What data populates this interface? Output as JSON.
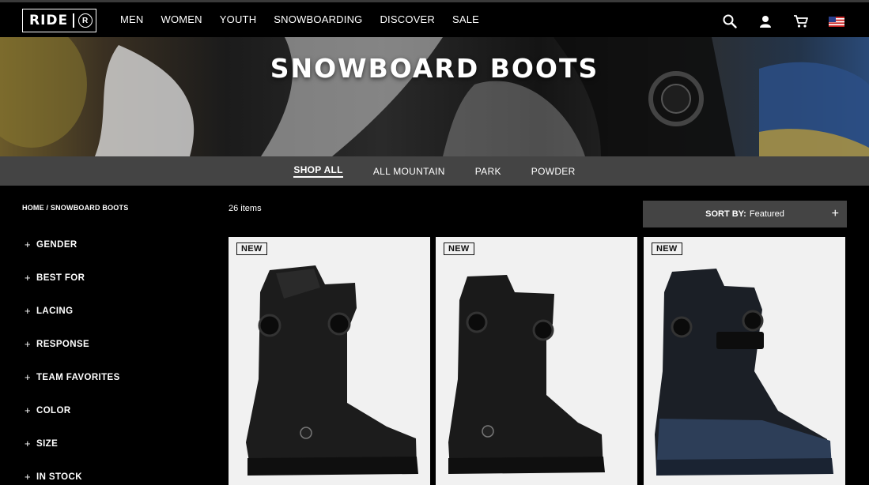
{
  "brand": {
    "name": "RIDE",
    "mark": "R"
  },
  "nav": [
    {
      "label": "MEN"
    },
    {
      "label": "WOMEN"
    },
    {
      "label": "YOUTH"
    },
    {
      "label": "SNOWBOARDING"
    },
    {
      "label": "DISCOVER"
    },
    {
      "label": "SALE"
    }
  ],
  "utilities": [
    "search-icon",
    "account-icon",
    "cart-icon",
    "us-flag-icon"
  ],
  "hero": {
    "title": "SNOWBOARD BOOTS"
  },
  "categories": [
    {
      "label": "SHOP ALL",
      "active": true
    },
    {
      "label": "ALL MOUNTAIN",
      "active": false
    },
    {
      "label": "PARK",
      "active": false
    },
    {
      "label": "POWDER",
      "active": false
    }
  ],
  "breadcrumb": "HOME / SNOWBOARD BOOTS",
  "filters": [
    {
      "label": "GENDER"
    },
    {
      "label": "BEST FOR"
    },
    {
      "label": "LACING"
    },
    {
      "label": "RESPONSE"
    },
    {
      "label": "TEAM FAVORITES"
    },
    {
      "label": "COLOR"
    },
    {
      "label": "SIZE"
    },
    {
      "label": "IN STOCK"
    }
  ],
  "results": {
    "count": "26 items"
  },
  "sort": {
    "label": "SORT BY:",
    "value": "Featured",
    "toggle": "+"
  },
  "products": [
    {
      "badge": "NEW",
      "color": "black"
    },
    {
      "badge": "NEW",
      "color": "black"
    },
    {
      "badge": "NEW",
      "color": "navy"
    }
  ],
  "colors": {
    "nav_bg": "#000000",
    "bar_bg": "#444444",
    "card_bg": "#f1f1f1"
  }
}
